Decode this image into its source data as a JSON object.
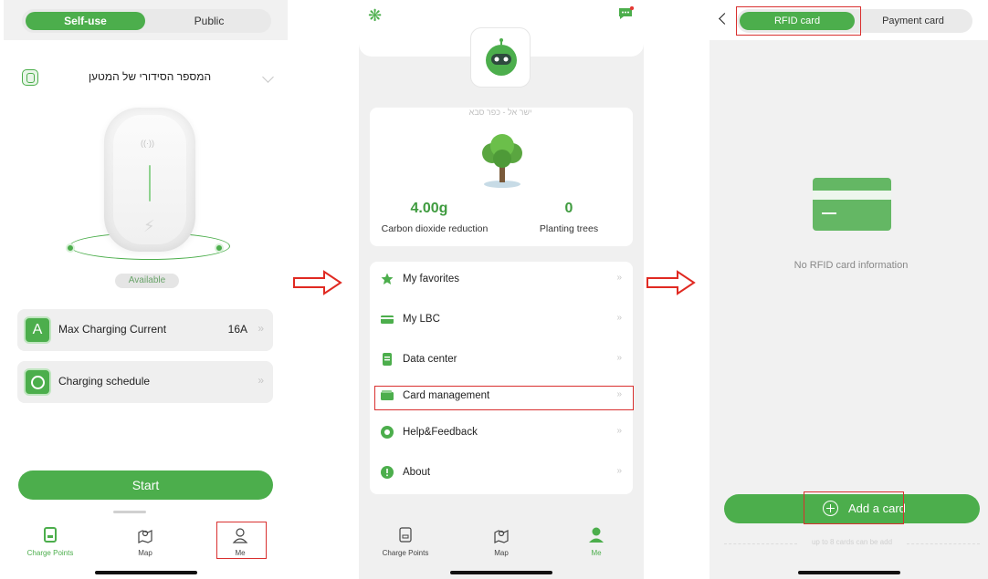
{
  "screen1": {
    "tabs": [
      "Self-use",
      "Public"
    ],
    "charger_name": "המספר הסידורי של המטען",
    "status": "Available",
    "options": [
      {
        "label": "Max Charging Current",
        "value": "16A",
        "arrow": "»"
      },
      {
        "label": "Charging schedule",
        "value": "",
        "arrow": "»"
      }
    ],
    "start_label": "Start",
    "tabbar": [
      "Charge Points",
      "Map",
      "Me"
    ],
    "icon_current": "A"
  },
  "screen2": {
    "username": "ישר אל - כפר סבא",
    "carbon_value": "4.00g",
    "carbon_label": "Carbon dioxide reduction",
    "trees_value": "0",
    "trees_label": "Planting trees",
    "menu": [
      {
        "label": "My favorites",
        "icon": "star-icon",
        "arrow": "»"
      },
      {
        "label": "My LBC",
        "icon": "card-icon",
        "arrow": "»"
      },
      {
        "label": "Data center",
        "icon": "document-icon",
        "arrow": "»"
      },
      {
        "label": "Card management",
        "icon": "wallet-icon",
        "arrow": "»"
      },
      {
        "label": "Help&Feedback",
        "icon": "help-icon",
        "arrow": "»"
      },
      {
        "label": "About",
        "icon": "info-icon",
        "arrow": "»"
      }
    ],
    "tabbar": [
      "Charge Points",
      "Map",
      "Me"
    ]
  },
  "screen3": {
    "tabs": [
      "RFID card",
      "Payment card"
    ],
    "empty_text": "No RFID card information",
    "add_label": "Add a card",
    "limit_text": "up to 8 cards can be add"
  },
  "colors": {
    "accent": "#4cae4c",
    "highlight": "#d9302f"
  }
}
